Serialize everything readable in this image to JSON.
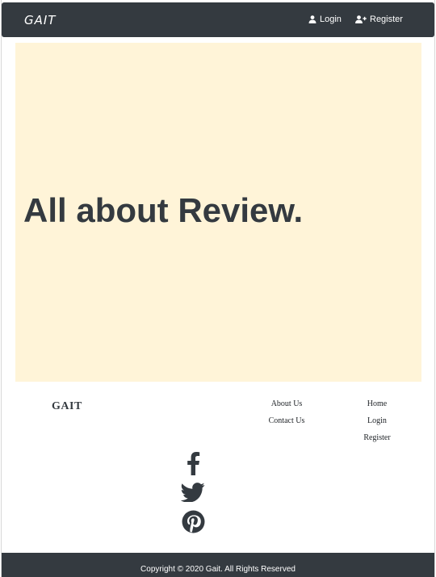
{
  "navbar": {
    "brand": "GAIT",
    "login_label": "Login",
    "register_label": "Register"
  },
  "hero": {
    "title": "All about Review."
  },
  "footer": {
    "brand": "GAIT",
    "column_1": [
      "About Us",
      "Contact Us"
    ],
    "column_2": [
      "Home",
      "Login",
      "Register"
    ],
    "social_icons": [
      "facebook-icon",
      "twitter-icon",
      "pinterest-icon"
    ],
    "copyright": "Copyright © 2020 Gait. All Rights Reserved"
  },
  "colors": {
    "navbar": "#343a40",
    "hero_background": "#fff4d8",
    "text_dark": "#343a40"
  }
}
